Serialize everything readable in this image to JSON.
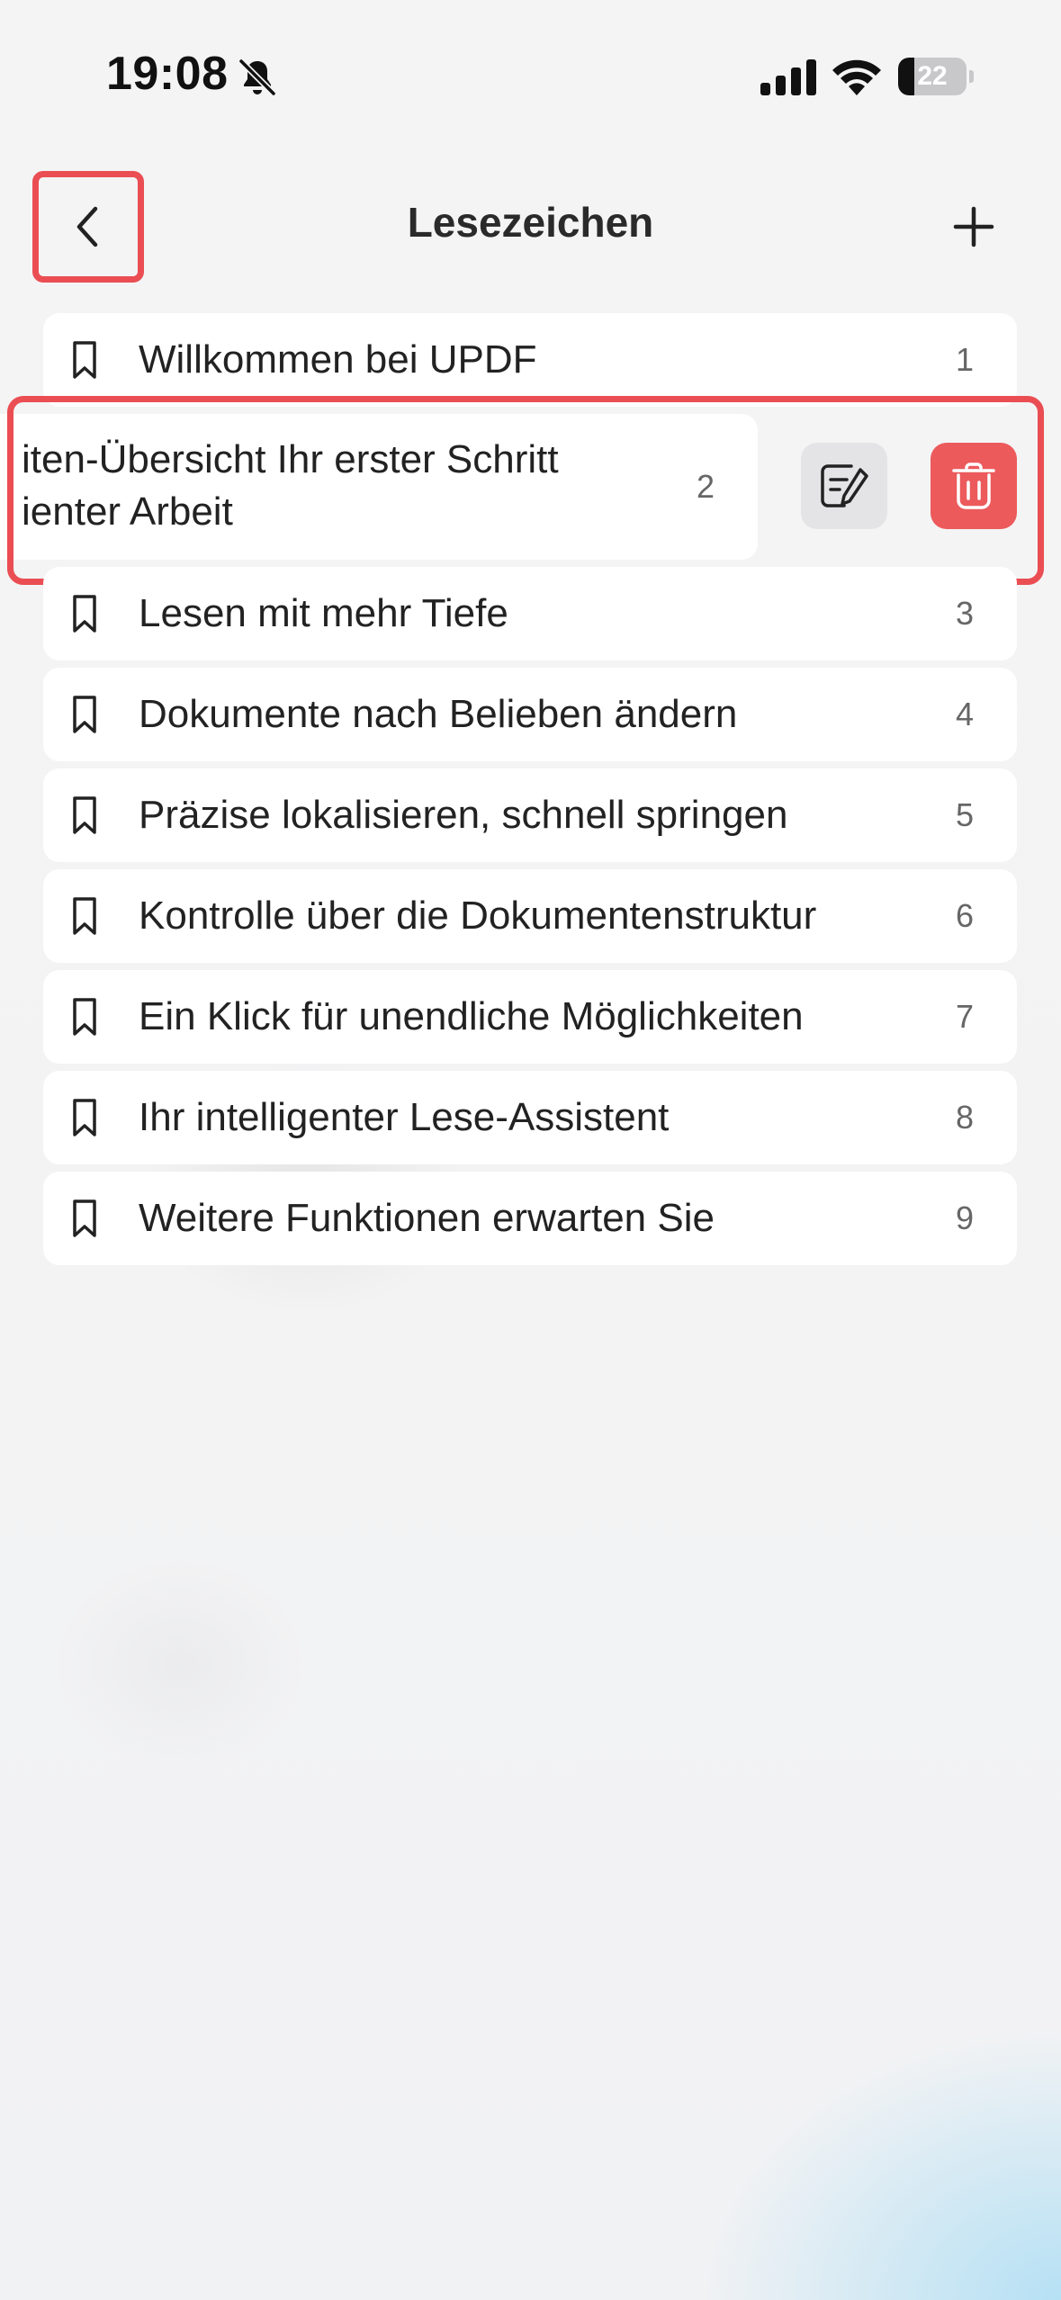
{
  "status_bar": {
    "time": "19:08",
    "battery_level": "22",
    "icons": [
      "bell-slash-icon",
      "cellular-signal-icon",
      "wifi-icon",
      "battery-icon"
    ]
  },
  "header": {
    "title": "Lesezeichen",
    "back_icon": "chevron-left-icon",
    "add_icon": "plus-icon"
  },
  "bookmarks": [
    {
      "label": "Willkommen bei UPDF",
      "page": "1"
    },
    {
      "label": "iten-Übersicht Ihr erster Schritt ienter Arbeit",
      "page": "2",
      "swiped": true
    },
    {
      "label": "Lesen mit mehr Tiefe",
      "page": "3"
    },
    {
      "label": "Dokumente nach Belieben ändern",
      "page": "4"
    },
    {
      "label": "Präzise lokalisieren, schnell springen",
      "page": "5"
    },
    {
      "label": "Kontrolle über die Dokumentenstruktur",
      "page": "6"
    },
    {
      "label": "Ein Klick für unendliche Möglichkeiten",
      "page": "7"
    },
    {
      "label": "Ihr intelligenter Lese-Assistent",
      "page": "8"
    },
    {
      "label": "Weitere Funktionen erwarten Sie",
      "page": "9"
    }
  ],
  "swiped_row": {
    "line1": "iten-Übersicht Ihr erster Schritt",
    "line2": "ienter Arbeit",
    "page": "2",
    "actions": {
      "edit_icon": "edit-note-icon",
      "delete_icon": "trash-icon"
    }
  },
  "colors": {
    "highlight": "#ea4e53",
    "delete_bg": "#ec5a5c",
    "edit_bg": "#e4e4e6",
    "row_bg": "#ffffff"
  }
}
